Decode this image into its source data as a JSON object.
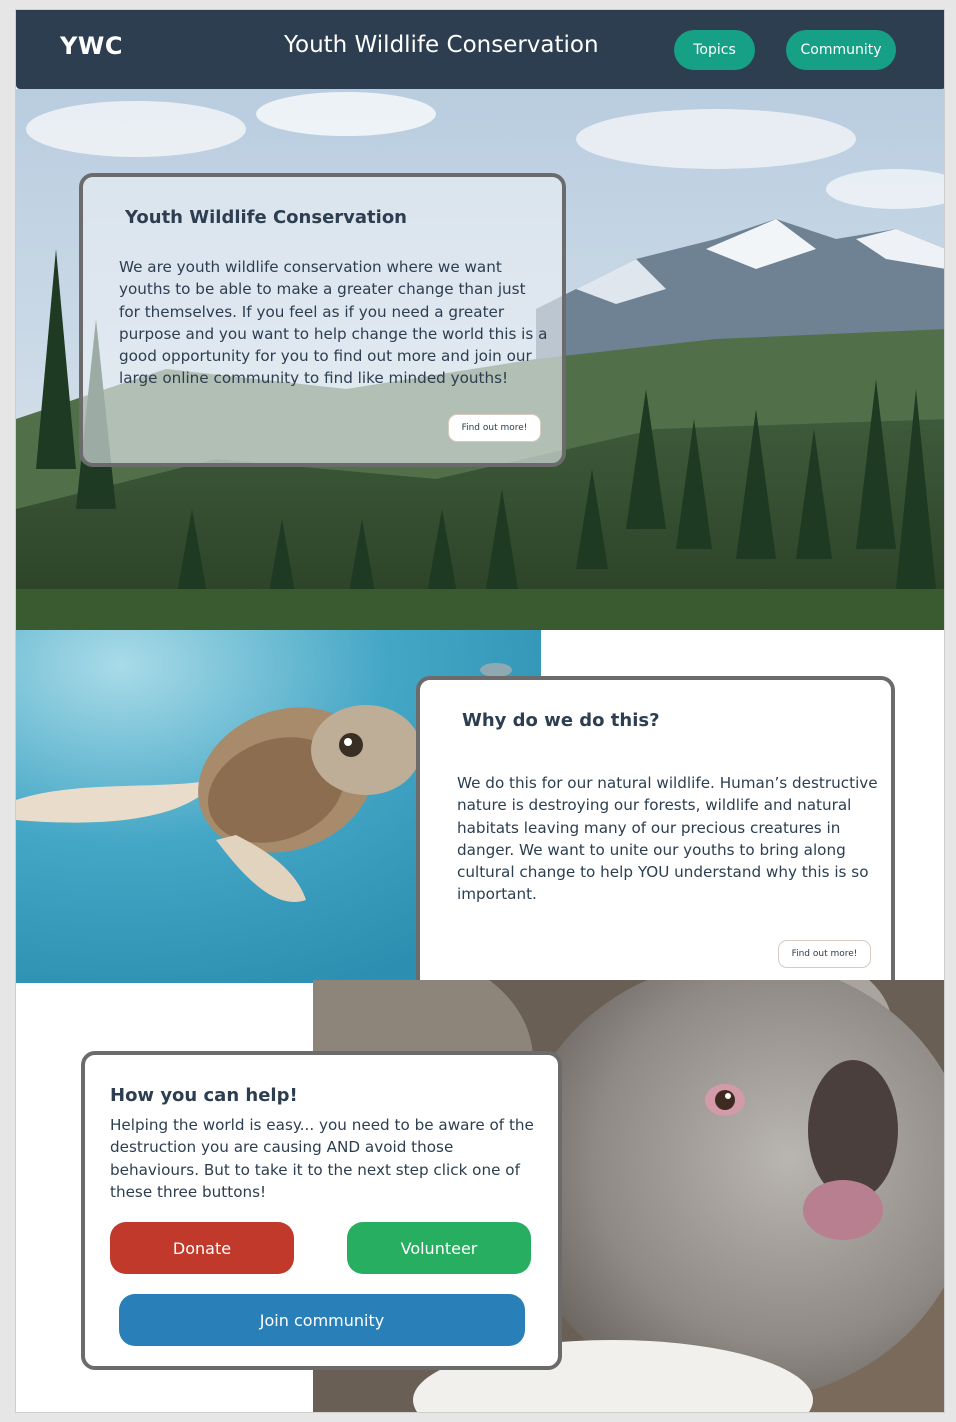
{
  "header": {
    "logo": "YWC",
    "title": "Youth Wildlife Conservation",
    "nav": [
      {
        "label": "Topics"
      },
      {
        "label": "Community"
      }
    ]
  },
  "hero": {
    "heading": "Youth Wildlife Conservation",
    "body": "We are youth wildlife conservation where we want youths to be able to make a greater change than just for themselves. If you feel as if you need a greater purpose and you want to help change the world this is a good opportunity for you to find out more and join our large online community to find like minded youths!",
    "button_label": "Find out more!"
  },
  "why": {
    "heading": "Why do we do this?",
    "body": "We do this for our natural wildlife. Human’s destructive nature is destroying our forests, wildlife and natural habitats leaving many of our precious creatures in danger. We want to unite our youths to bring along cultural change to help YOU understand why this is so important.",
    "button_label": "Find out more!"
  },
  "help": {
    "heading": "How you can help!",
    "body": "Helping the world is easy... you need to be aware of the destruction you are causing AND avoid those behaviours. But to take it to the next step click one of these three buttons!",
    "buttons": {
      "donate": "Donate",
      "volunteer": "Volunteer",
      "join": "Join community"
    }
  },
  "colors": {
    "header_bg": "#2c3e50",
    "nav_button": "#16a085",
    "donate": "#c0392b",
    "volunteer": "#27ae60",
    "join": "#2980b9"
  },
  "images": {
    "hero": "mountain-forest-landscape-photo",
    "turtle": "sea-turtle-photo",
    "koala": "koala-photo"
  }
}
